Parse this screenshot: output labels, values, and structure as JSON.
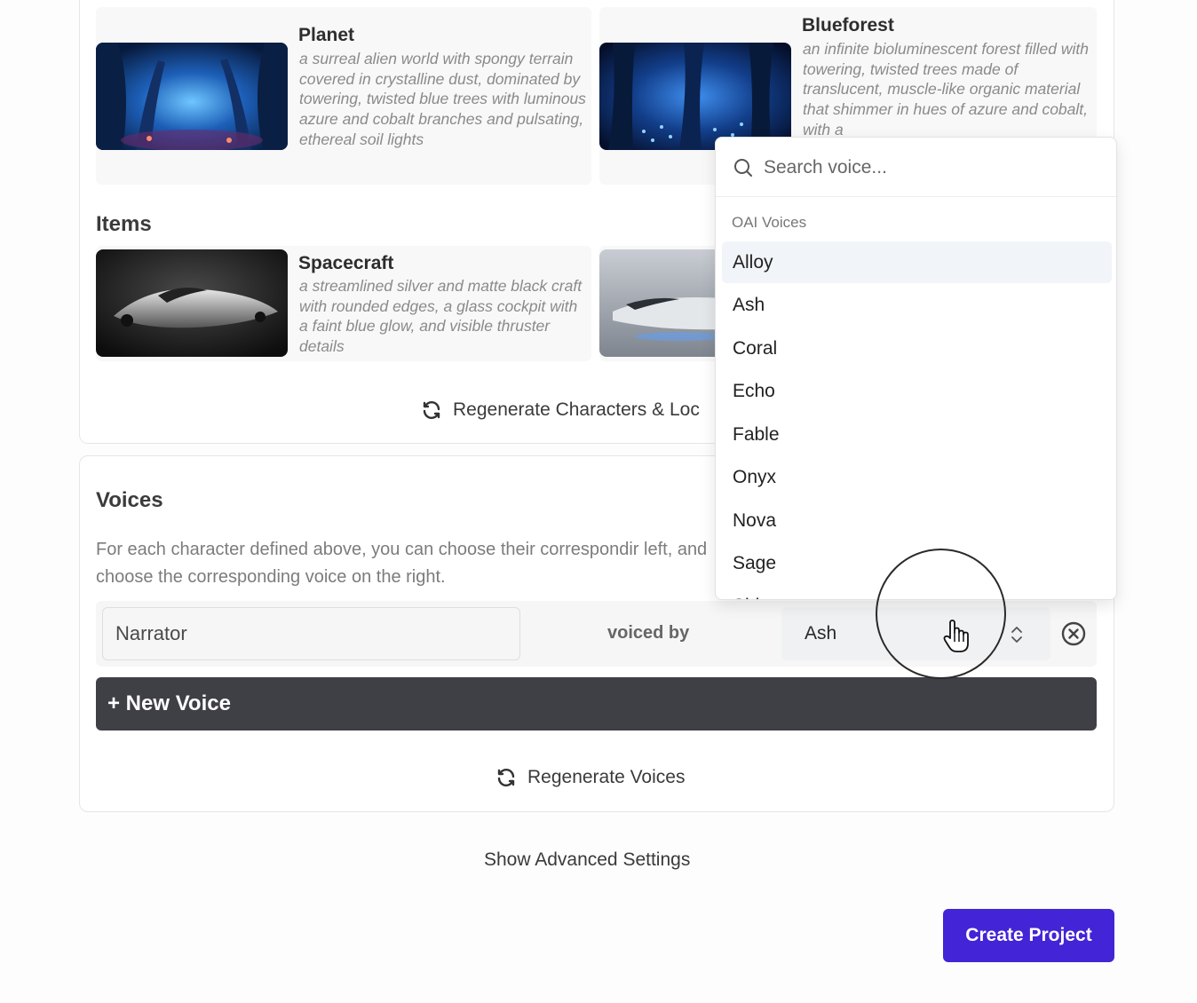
{
  "locations": {
    "cards": [
      {
        "title": "Planet",
        "description": "a surreal alien world with spongy terrain covered in crystalline dust, dominated by towering, twisted blue trees with luminous azure and cobalt branches and pulsating, ethereal soil lights"
      },
      {
        "title": "Blueforest",
        "description": "an infinite bioluminescent forest filled with towering, twisted trees made of translucent, muscle-like organic material that shimmer in hues of azure and cobalt, with a"
      }
    ]
  },
  "items": {
    "heading": "Items",
    "cards": [
      {
        "title": "Spacecraft",
        "description": "a streamlined silver and matte black craft with rounded edges, a glass cockpit with a faint blue glow, and visible thruster details"
      }
    ]
  },
  "regenerate_characters_label": "Regenerate Characters & Loc",
  "voices": {
    "heading": "Voices",
    "description": "For each character defined above, you can choose their correspondir left, and choose the corresponding voice on the right.",
    "row": {
      "character": "Narrator",
      "voiced_by_label": "voiced by",
      "selected_voice": "Ash"
    },
    "new_voice_label": "+ New Voice",
    "regenerate_label": "Regenerate Voices"
  },
  "advanced_label": "Show Advanced Settings",
  "create_label": "Create Project",
  "dropdown": {
    "search_placeholder": "Search voice...",
    "group_label": "OAI Voices",
    "options": [
      "Alloy",
      "Ash",
      "Coral",
      "Echo",
      "Fable",
      "Onyx",
      "Nova",
      "Sage",
      "Shimmer"
    ],
    "highlighted": "Alloy"
  },
  "colors": {
    "primary_button": "#4324d6",
    "dark_button": "#3f3f46"
  }
}
